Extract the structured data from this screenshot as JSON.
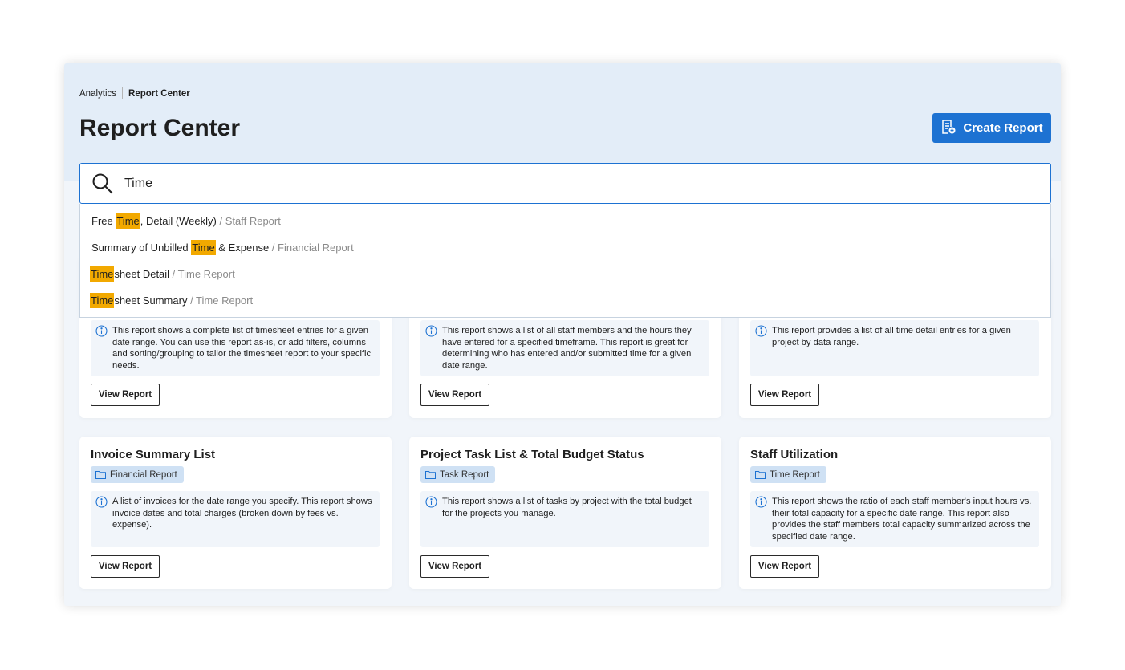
{
  "breadcrumb": {
    "root": "Analytics",
    "current": "Report Center"
  },
  "page": {
    "title": "Report Center"
  },
  "create_button": {
    "label": "Create Report"
  },
  "search": {
    "value": "Time"
  },
  "suggestions": [
    {
      "before": "Free ",
      "match": "Time",
      "after": ", Detail (Weekly)",
      "category": " / Staff Report"
    },
    {
      "before": "Summary of Unbilled ",
      "match": "Time",
      "after": " & Expense",
      "category": " / Financial Report"
    },
    {
      "before": "",
      "match": "Time",
      "after": "sheet Detail",
      "category": " / Time Report"
    },
    {
      "before": "",
      "match": "Time",
      "after": "sheet Summary",
      "category": " / Time Report"
    }
  ],
  "row1_cards": [
    {
      "description": "This report shows a complete list of timesheet entries for a given date range. You can use this report as-is, or add filters, columns and sorting/grouping to tailor the timesheet report to your specific needs.",
      "button": "View Report"
    },
    {
      "description": "This report shows a list of all staff members and the hours they have entered for a specified timeframe. This report is great for determining who has entered and/or submitted time for a given date range.",
      "button": "View Report"
    },
    {
      "description": "This report provides a list of all time detail entries for a given project by data range.",
      "button": "View Report"
    }
  ],
  "row2_cards": [
    {
      "title": "Invoice Summary List",
      "tag": "Financial Report",
      "description": "A list of invoices for the date range you specify. This report shows invoice dates and total charges (broken down by fees vs. expense).",
      "button": "View Report"
    },
    {
      "title": "Project Task List & Total Budget Status",
      "tag": "Task Report",
      "description": "This report shows a list of tasks by project with the total budget for the projects you manage.",
      "button": "View Report"
    },
    {
      "title": "Staff Utilization",
      "tag": "Time Report",
      "description": "This report shows the ratio of each staff member's input hours vs. their total capacity for a specific date range. This report also provides the staff members total capacity summarized across the specified date range.",
      "button": "View Report"
    }
  ],
  "colors": {
    "accent": "#1d72d2",
    "highlight": "#f2a900",
    "tag_bg": "#cfe1f4",
    "header_bg": "#e3edf8"
  }
}
